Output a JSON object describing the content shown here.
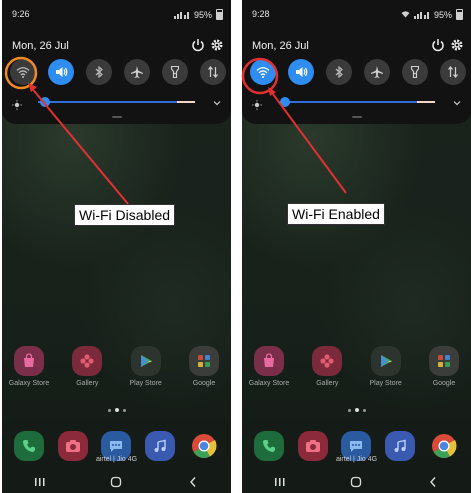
{
  "screens": [
    {
      "time": "9:26",
      "battery": "95%",
      "date": "Mon, 26 Jul",
      "wifi_on": false,
      "home_apps": [
        "Galaxy Store",
        "Gallery",
        "Play Store",
        "Google"
      ],
      "carrier": "airtel | Jio 4G",
      "annotation": "Wi-Fi Disabled"
    },
    {
      "time": "9:28",
      "battery": "95%",
      "date": "Mon, 26 Jul",
      "wifi_on": true,
      "home_apps": [
        "Galaxy Store",
        "Gallery",
        "Play Store",
        "Google"
      ],
      "carrier": "airtel | Jio 4G",
      "annotation": "Wi-Fi Enabled"
    }
  ],
  "colors": {
    "accent_blue": "#2f8cf0",
    "annotation_orange": "#f08a24",
    "annotation_red": "#e23030",
    "tile_off": "#3a3a3a"
  },
  "quick_settings_icons": [
    "wifi-icon",
    "sound-icon",
    "bluetooth-icon",
    "airplane-mode-icon",
    "flashlight-icon",
    "mobile-data-icon"
  ],
  "dock_icons": [
    "phone-icon",
    "camera-icon",
    "messages-icon",
    "music-icon",
    "chrome-icon"
  ]
}
